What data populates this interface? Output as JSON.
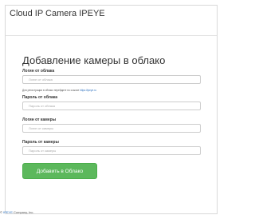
{
  "header": {
    "brand": "Cloud IP Camera IPEYE"
  },
  "form": {
    "title": "Добавление камеры в облако",
    "cloud_login": {
      "label": "Логин от облака",
      "placeholder": "Логин от облака"
    },
    "registration_hint": {
      "text": "Для регистрации в облако перейдите по ссылке",
      "link": "https://ipeye.ru"
    },
    "cloud_password": {
      "label": "Пароль от облака",
      "placeholder": "Пароль от облака"
    },
    "camera_login": {
      "label": "Логин от камеры",
      "placeholder": "Логин от камеры"
    },
    "camera_password": {
      "label": "Пароль от камеры",
      "placeholder": "Пароль от камеры"
    },
    "submit_label": "Добавить в Облако"
  },
  "footer": {
    "copyright": "©",
    "company_link": "IPEYE",
    "company_suffix": "Company, Inc."
  },
  "colors": {
    "button": "#5cb85c",
    "link": "#2a6fbe"
  }
}
